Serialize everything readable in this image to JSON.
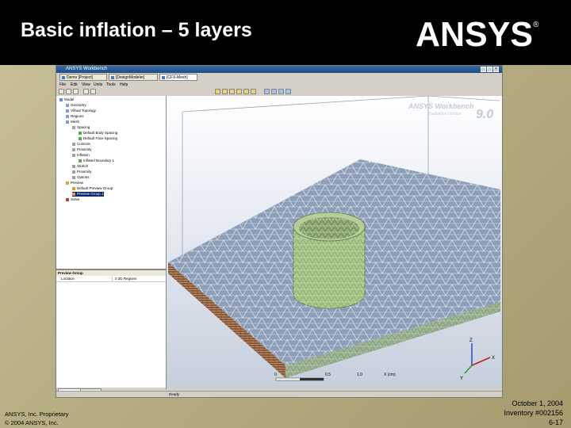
{
  "slide": {
    "title": "Basic inflation – 5 layers",
    "logo_text": "ANSYS",
    "logo_mark": "®"
  },
  "window": {
    "title": "ANSYS Workbench",
    "tabs": [
      "Demo [Project]",
      "[DesignModeler]",
      "[CFX-Mesh]"
    ],
    "menus": [
      "File",
      "Edit",
      "View",
      "Units",
      "Tools",
      "Help"
    ]
  },
  "tree": {
    "items": [
      {
        "label": "Model",
        "indent": 0
      },
      {
        "label": "Geometry",
        "indent": 1
      },
      {
        "label": "Virtual Topology",
        "indent": 1
      },
      {
        "label": "Regions",
        "indent": 1
      },
      {
        "label": "Mesh",
        "indent": 1
      },
      {
        "label": "Spacing",
        "indent": 2
      },
      {
        "label": "Default Body Spacing",
        "indent": 3
      },
      {
        "label": "Default Face Spacing",
        "indent": 3
      },
      {
        "label": "Controls",
        "indent": 2
      },
      {
        "label": "Proximity",
        "indent": 2
      },
      {
        "label": "Inflation",
        "indent": 2
      },
      {
        "label": "Inflated Boundary 1",
        "indent": 3
      },
      {
        "label": "Stretch",
        "indent": 2
      },
      {
        "label": "Proximity",
        "indent": 2
      },
      {
        "label": "Options",
        "indent": 2
      },
      {
        "label": "Preview",
        "indent": 1
      },
      {
        "label": "Default Preview Group",
        "indent": 2
      },
      {
        "label": "Preview Group 1",
        "indent": 2,
        "selected": true
      },
      {
        "label": "Solve",
        "indent": 1
      }
    ]
  },
  "details": {
    "header": "Preview Group",
    "row_label": "Location",
    "row_value": "2 2D Regions"
  },
  "bottom_tabs": [
    "Parameters",
    "Messages"
  ],
  "viewport": {
    "watermark": "ANSYS Workbench",
    "watermark_sub": "Evaluation Version",
    "version": "9.0",
    "scale_labels": [
      "0",
      "0.5",
      "1.0"
    ],
    "scale_unit": "X (cm)",
    "axis_labels": [
      "Z",
      "X",
      "Y"
    ],
    "colors": {
      "mesh": "#8d9fb8",
      "cylinder": "#9bbd7c",
      "layers": "#8a5a3a"
    }
  },
  "status": {
    "text": "Ready"
  },
  "footer": {
    "left_line1": "ANSYS, Inc. Proprietary",
    "left_line2": "© 2004 ANSYS, Inc.",
    "right_line1": "October 1, 2004",
    "right_line2": "Inventory #002156",
    "right_line3": "6-17"
  }
}
